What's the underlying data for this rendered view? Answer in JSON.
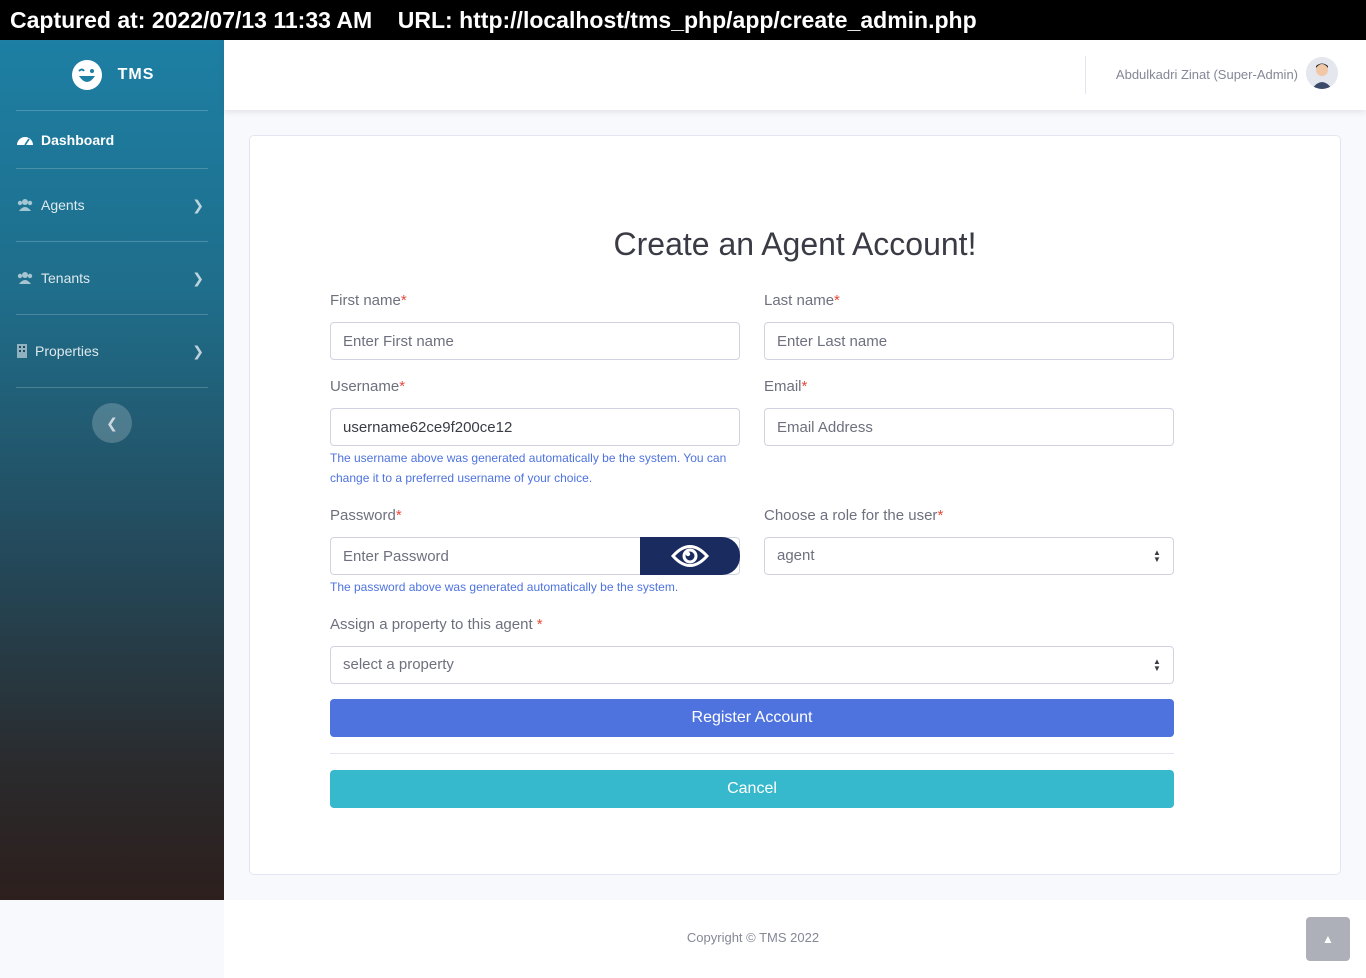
{
  "capture": {
    "text": "Captured at: 2022/07/13 11:33 AM    URL: http://localhost/tms_php/app/create_admin.php"
  },
  "sidebar": {
    "brand": "TMS",
    "items": [
      {
        "label": "Dashboard",
        "icon": "tachometer-icon",
        "active": true
      },
      {
        "label": "Agents",
        "icon": "users-icon"
      },
      {
        "label": "Tenants",
        "icon": "users-icon"
      },
      {
        "label": "Properties",
        "icon": "building-icon"
      }
    ]
  },
  "topbar": {
    "user": "Abdulkadri Zinat (Super-Admin)"
  },
  "form": {
    "title": "Create an Agent Account!",
    "first_name_label": "First name",
    "first_name_placeholder": "Enter First name",
    "last_name_label": "Last name",
    "last_name_placeholder": "Enter Last name",
    "username_label": "Username",
    "username_value": "username62ce9f200ce12",
    "username_help": "The username above was generated automatically be the system. You can change it to a preferred username of your choice.",
    "email_label": "Email",
    "email_placeholder": "Email Address",
    "password_label": "Password",
    "password_placeholder": "Enter Password",
    "password_help": "The password above was generated automatically be the system.",
    "role_label": "Choose a role for the user",
    "role_value": "agent",
    "property_label": "Assign a property to this agent ",
    "property_value": "select a property",
    "required_mark": "*",
    "register_label": "Register Account",
    "cancel_label": "Cancel"
  },
  "footer": {
    "copyright": "Copyright © TMS 2022"
  },
  "colors": {
    "primary": "#4e73df",
    "info": "#36b9cc",
    "danger": "#e74a3b",
    "eye_button": "#1a2b5f"
  }
}
